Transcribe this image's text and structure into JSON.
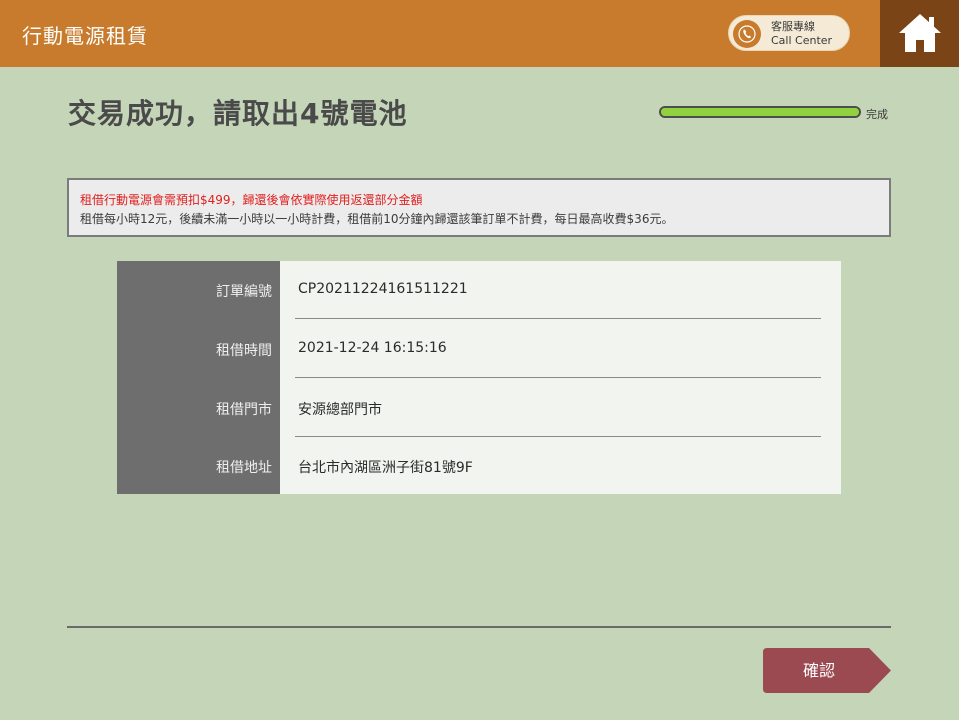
{
  "header": {
    "app_title": "行動電源租賃",
    "call_center_line1": "客服專線",
    "call_center_line2": "Call Center"
  },
  "main": {
    "title": "交易成功，請取出4號電池",
    "progress_label": "完成",
    "progress_fraction": 1.0
  },
  "notice": {
    "warning": "租借行動電源會需預扣$499，歸還後會依實際使用返還部分金額",
    "pricing": "租借每小時12元，後續未滿一小時以一小時計費，租借前10分鐘內歸還該筆訂單不計費，每日最高收費$36元。"
  },
  "order": {
    "rows": [
      {
        "label": "訂單編號",
        "value": "CP20211224161511221"
      },
      {
        "label": "租借時間",
        "value": "2021-12-24 16:15:16"
      },
      {
        "label": "租借門市",
        "value": "安源總部門市"
      },
      {
        "label": "租借地址",
        "value": "台北市內湖區洲子街81號9F"
      }
    ]
  },
  "actions": {
    "confirm_label": "確認"
  },
  "icons": {
    "phone": "phone-icon",
    "home": "home-icon"
  },
  "colors": {
    "header_bg": "#c87b2c",
    "home_bg": "#7a4416",
    "page_bg": "#c5d6b8",
    "warning_text": "#e02020",
    "progress_fill": "#8fd13f",
    "confirm_bg": "#9b4a52"
  }
}
